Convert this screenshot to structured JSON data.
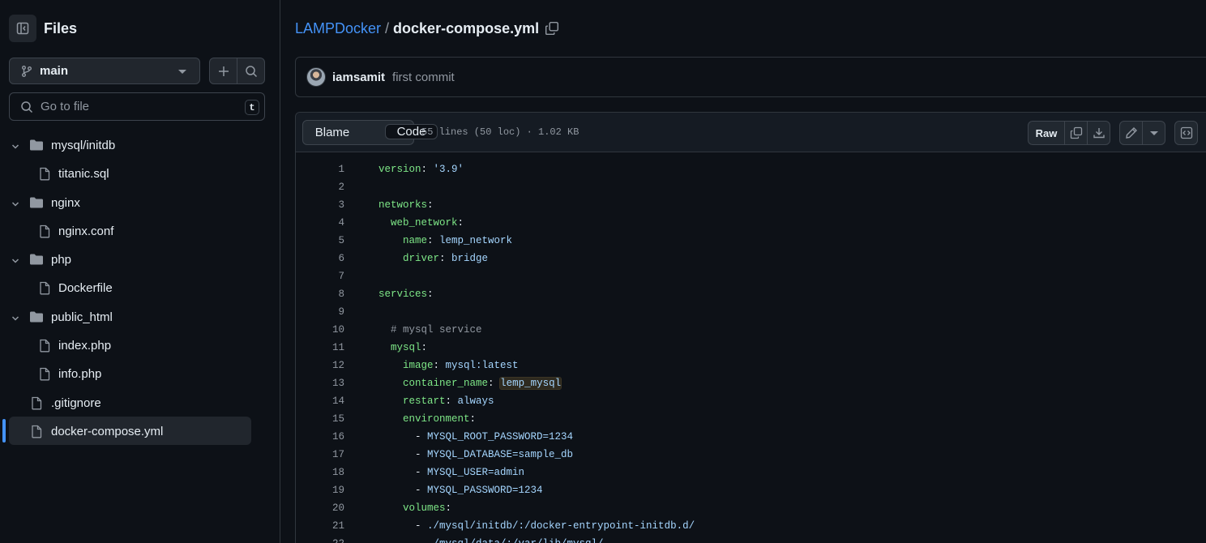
{
  "sidebar": {
    "title": "Files",
    "branch": "main",
    "search_placeholder": "Go to file",
    "search_shortcut": "t",
    "tree": [
      {
        "label": "mysql/initdb",
        "type": "folder",
        "depth": 0,
        "expanded": true
      },
      {
        "label": "titanic.sql",
        "type": "file",
        "depth": 1
      },
      {
        "label": "nginx",
        "type": "folder",
        "depth": 0,
        "expanded": true
      },
      {
        "label": "nginx.conf",
        "type": "file",
        "depth": 1
      },
      {
        "label": "php",
        "type": "folder",
        "depth": 0,
        "expanded": true
      },
      {
        "label": "Dockerfile",
        "type": "file",
        "depth": 1
      },
      {
        "label": "public_html",
        "type": "folder",
        "depth": 0,
        "expanded": true
      },
      {
        "label": "index.php",
        "type": "file",
        "depth": 1
      },
      {
        "label": "info.php",
        "type": "file",
        "depth": 1
      },
      {
        "label": ".gitignore",
        "type": "file",
        "depth": 0
      },
      {
        "label": "docker-compose.yml",
        "type": "file",
        "depth": 0,
        "active": true
      }
    ]
  },
  "breadcrumb": {
    "repo": "LAMPDocker",
    "separator": "/",
    "file": "docker-compose.yml"
  },
  "commit": {
    "user": "iamsamit",
    "message": "first commit"
  },
  "file_header": {
    "tab_code": "Code",
    "tab_blame": "Blame",
    "meta": "55 lines (50 loc) · 1.02 KB",
    "raw_label": "Raw"
  },
  "code_lines": [
    "version: '3.9'",
    "",
    "networks:",
    "  web_network:",
    "    name: lemp_network",
    "    driver: bridge",
    "",
    "services:",
    "",
    "  # mysql service",
    "  mysql:",
    "    image: mysql:latest",
    "    container_name: lemp_mysql",
    "    restart: always",
    "    environment:",
    "      - MYSQL_ROOT_PASSWORD=1234",
    "      - MYSQL_DATABASE=sample_db",
    "      - MYSQL_USER=admin",
    "      - MYSQL_PASSWORD=1234",
    "    volumes:",
    "      - ./mysql/initdb/:/docker-entrypoint-initdb.d/",
    "      - ./mysql/data/:/var/lib/mysql/"
  ],
  "colors": {
    "accent": "#4493f8",
    "background": "#0d1117",
    "key": "#7ee787",
    "value": "#a5d6ff",
    "comment": "#9198a1"
  }
}
